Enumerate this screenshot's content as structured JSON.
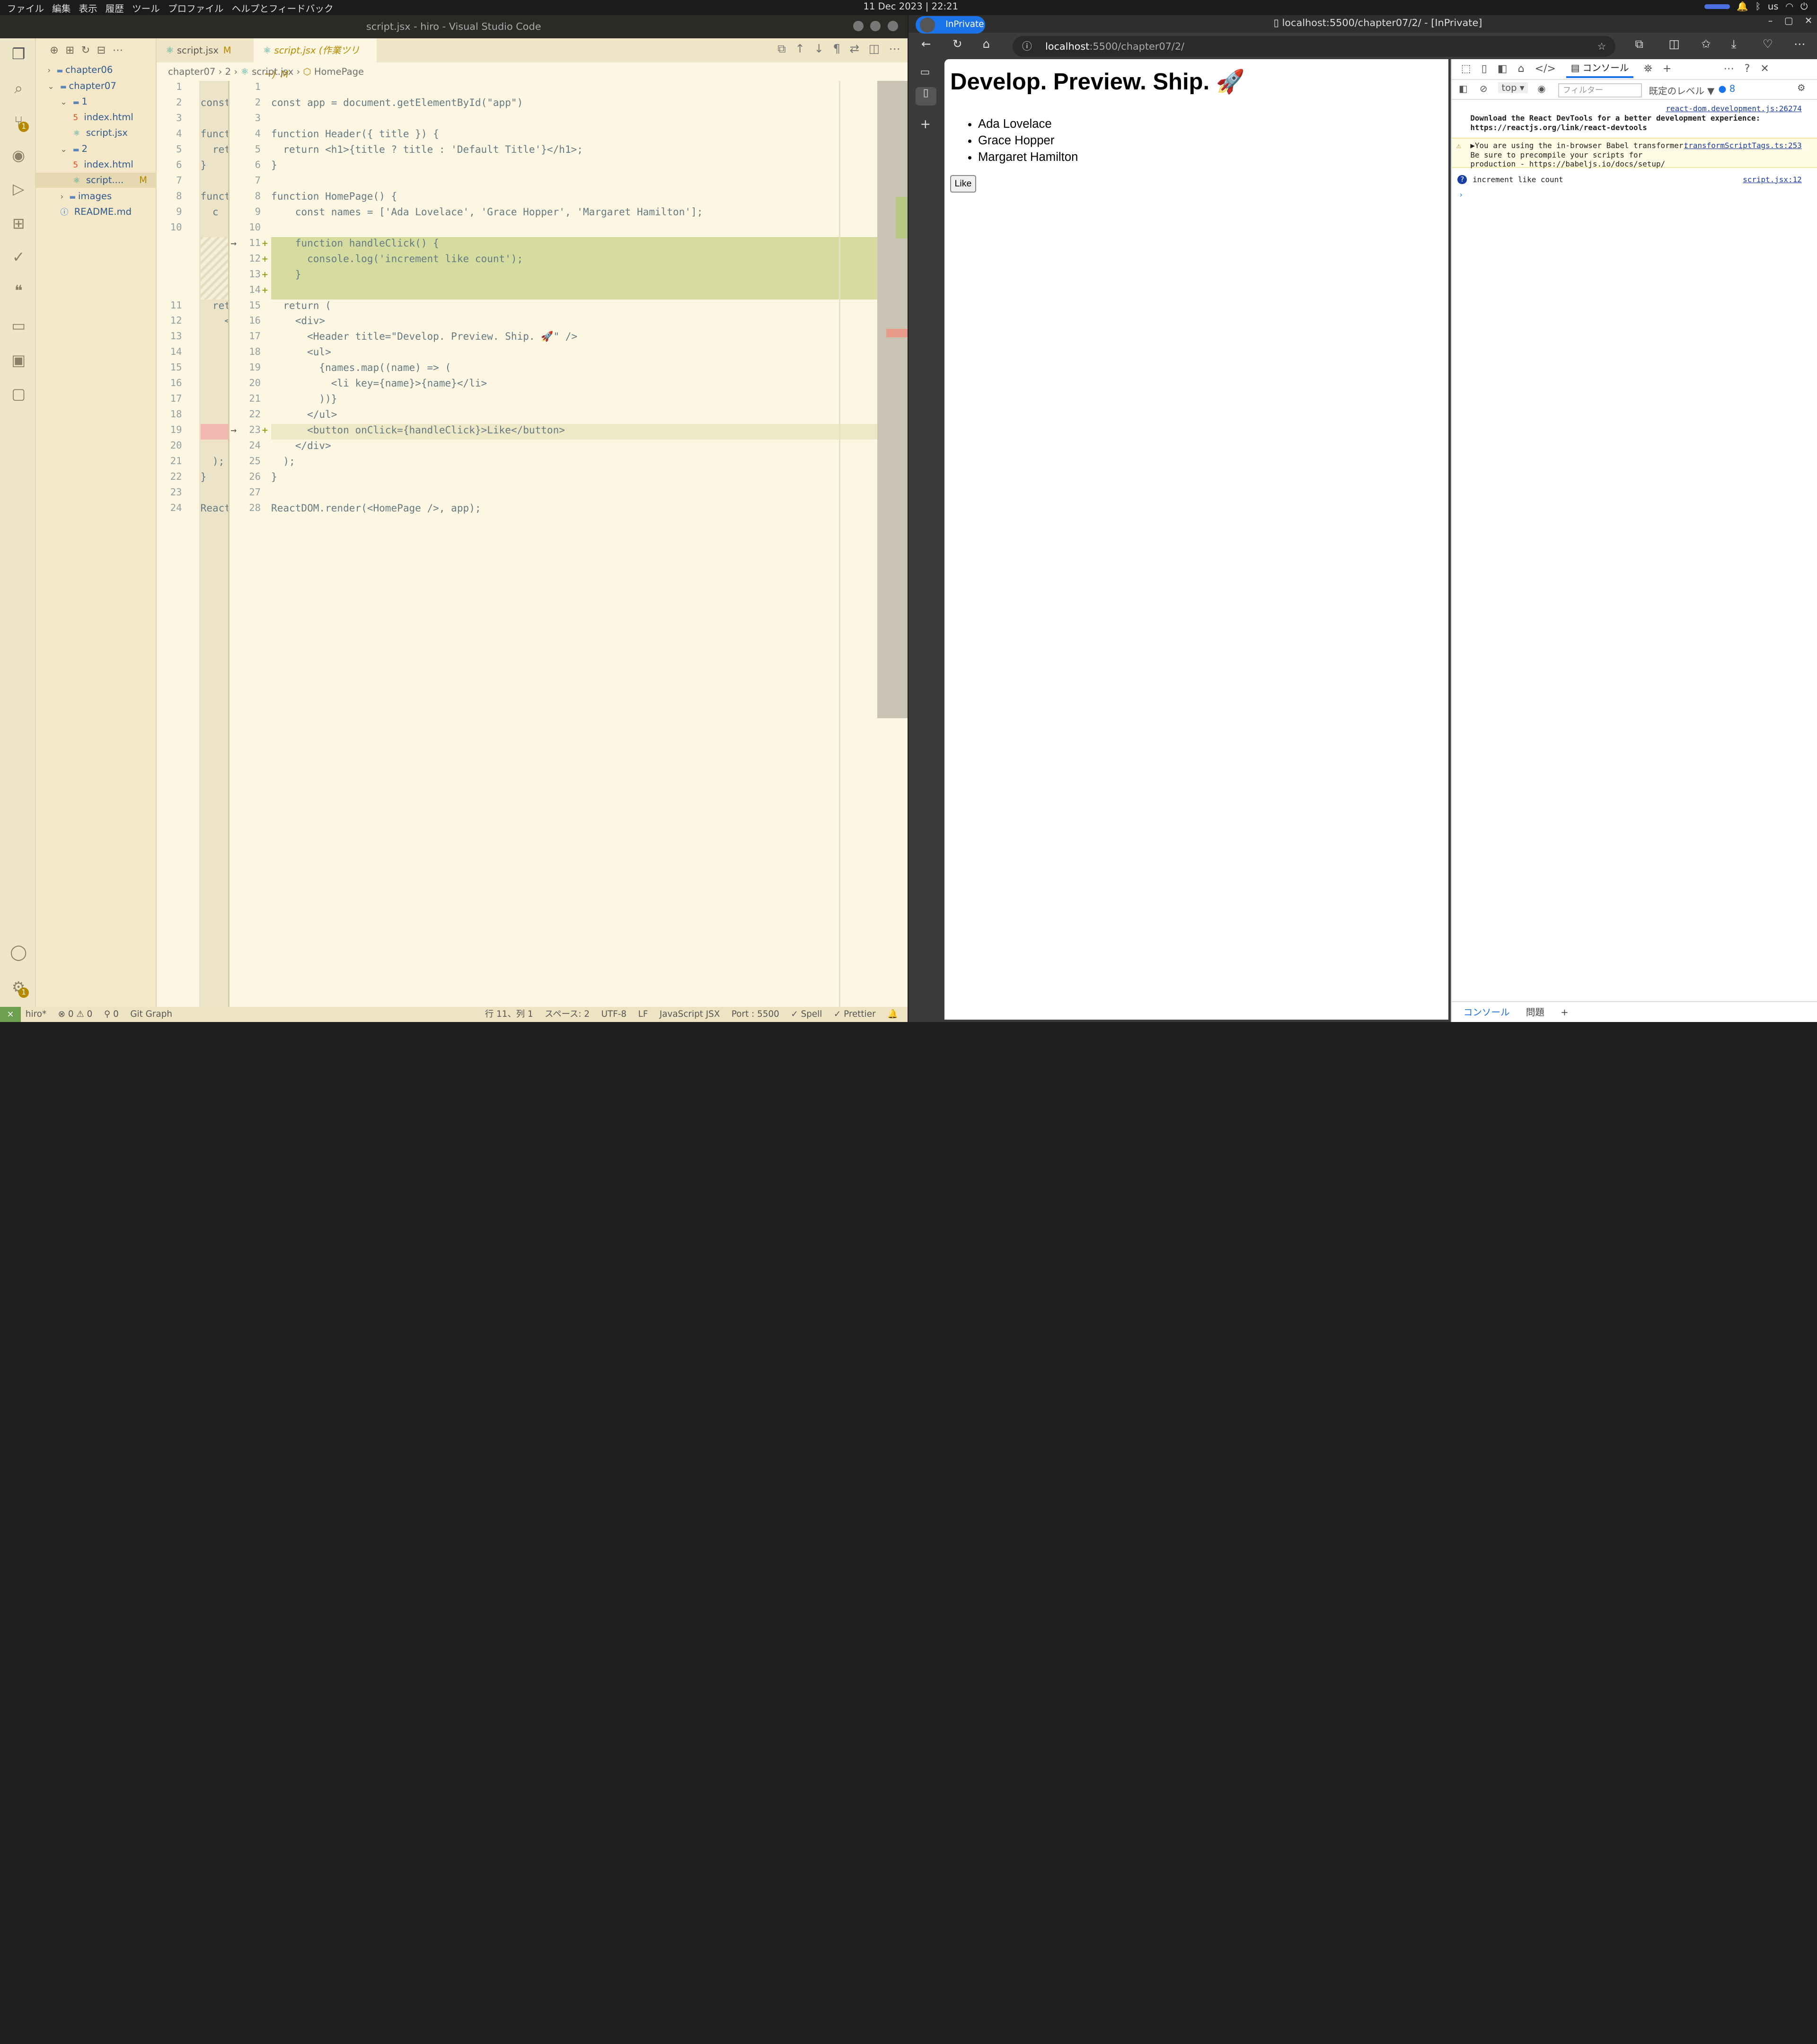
{
  "system": {
    "menu": [
      "ファイル",
      "編集",
      "表示",
      "履歴",
      "ツール",
      "プロファイル",
      "ヘルプとフィードバック"
    ],
    "clock": "11 Dec 2023 | 22:21",
    "keyboard": "us"
  },
  "vscode": {
    "title": "script.jsx - hiro - Visual Studio Code",
    "scm_badge": "1",
    "settings_badge": "1",
    "explorer": [
      {
        "label": "chapter06",
        "kind": "folder-closed",
        "depth": 0
      },
      {
        "label": "chapter07",
        "kind": "folder-open",
        "depth": 0
      },
      {
        "label": "1",
        "kind": "folder-open",
        "depth": 1
      },
      {
        "label": "index.html",
        "kind": "html",
        "depth": 2
      },
      {
        "label": "script.jsx",
        "kind": "jsx",
        "depth": 2
      },
      {
        "label": "2",
        "kind": "folder-open",
        "depth": 1
      },
      {
        "label": "index.html",
        "kind": "html",
        "depth": 2
      },
      {
        "label": "script....",
        "kind": "jsx",
        "depth": 2,
        "badge": "M"
      },
      {
        "label": "images",
        "kind": "folder-closed",
        "depth": 1
      },
      {
        "label": "README.md",
        "kind": "md",
        "depth": 1
      }
    ],
    "tabs": [
      {
        "label": "script.jsx",
        "badge": "M"
      },
      {
        "label": "script.jsx (作業ツリー)",
        "badge": "M"
      }
    ],
    "breadcrumb": [
      "chapter07",
      "2",
      "script.jsx",
      "HomePage"
    ],
    "left_lines": [
      {
        "n": "1",
        "t": ""
      },
      {
        "n": "2",
        "t": "const"
      },
      {
        "n": "3",
        "t": ""
      },
      {
        "n": "4",
        "t": "funct"
      },
      {
        "n": "5",
        "t": "  ret"
      },
      {
        "n": "6",
        "t": "}"
      },
      {
        "n": "7",
        "t": ""
      },
      {
        "n": "8",
        "t": "funct"
      },
      {
        "n": "9",
        "t": "  c"
      },
      {
        "n": "10",
        "t": ""
      },
      {
        "n": "11",
        "t": "  ret"
      },
      {
        "n": "12",
        "t": "    <"
      },
      {
        "n": "13",
        "t": ""
      },
      {
        "n": "14",
        "t": ""
      },
      {
        "n": "15",
        "t": ""
      },
      {
        "n": "16",
        "t": ""
      },
      {
        "n": "17",
        "t": ""
      },
      {
        "n": "18",
        "t": ""
      },
      {
        "n": "19",
        "t": ""
      },
      {
        "n": "20",
        "t": ""
      },
      {
        "n": "21",
        "t": "  );"
      },
      {
        "n": "22",
        "t": "}"
      },
      {
        "n": "23",
        "t": ""
      },
      {
        "n": "24",
        "t": "React"
      }
    ],
    "right_lines": [
      {
        "n": "1",
        "t": ""
      },
      {
        "n": "2",
        "t": "const app = document.getElementById(\"app\")"
      },
      {
        "n": "3",
        "t": ""
      },
      {
        "n": "4",
        "t": "function Header({ title }) {"
      },
      {
        "n": "5",
        "t": "  return <h1>{title ? title : 'Default Title'}</h1>;"
      },
      {
        "n": "6",
        "t": "}"
      },
      {
        "n": "7",
        "t": ""
      },
      {
        "n": "8",
        "t": "function HomePage() {"
      },
      {
        "n": "9",
        "t": "    const names = ['Ada Lovelace', 'Grace Hopper', 'Margaret Hamilton'];"
      },
      {
        "n": "10",
        "t": ""
      },
      {
        "n": "11",
        "t": "    function handleClick() {",
        "added": true
      },
      {
        "n": "12",
        "t": "      console.log('increment like count');",
        "added": true
      },
      {
        "n": "13",
        "t": "    }",
        "added": true
      },
      {
        "n": "14",
        "t": "",
        "added": true
      },
      {
        "n": "15",
        "t": "  return ("
      },
      {
        "n": "16",
        "t": "    <div>"
      },
      {
        "n": "17",
        "t": "      <Header title=\"Develop. Preview. Ship. 🚀\" />"
      },
      {
        "n": "18",
        "t": "      <ul>"
      },
      {
        "n": "19",
        "t": "        {names.map((name) => ("
      },
      {
        "n": "20",
        "t": "          <li key={name}>{name}</li>"
      },
      {
        "n": "21",
        "t": "        ))}"
      },
      {
        "n": "22",
        "t": "      </ul>"
      },
      {
        "n": "23",
        "t": "      <button onClick={handleClick}>Like</button>",
        "added": true
      },
      {
        "n": "24",
        "t": "    </div>"
      },
      {
        "n": "25",
        "t": "  );"
      },
      {
        "n": "26",
        "t": "}"
      },
      {
        "n": "27",
        "t": ""
      },
      {
        "n": "28",
        "t": "ReactDOM.render(<HomePage />, app);"
      }
    ],
    "status": {
      "remote": "⨯",
      "branch": "hiro*",
      "problems": "⊗ 0 ⚠ 0",
      "ports": "⚲ 0",
      "gitgraph": "Git Graph",
      "position": "行 11、列 1",
      "spaces": "スペース: 2",
      "encoding": "UTF-8",
      "eol": "LF",
      "language": "JavaScript JSX",
      "port": "Port : 5500",
      "spell": "✓ Spell",
      "prettier": "✓ Prettier"
    }
  },
  "browser": {
    "profile": "InPrivate",
    "title": "localhost:5500/chapter07/2/ - [InPrivate]",
    "url_host": "localhost",
    "url_path": ":5500/chapter07/2/",
    "page": {
      "heading": "Develop. Preview. Ship. 🚀",
      "items": [
        "Ada Lovelace",
        "Grace Hopper",
        "Margaret Hamilton"
      ],
      "button": "Like"
    },
    "devtools": {
      "tab_console": "コンソール",
      "context": "top",
      "filter_placeholder": "フィルター",
      "level": "既定のレベル ▼",
      "issues": "8",
      "messages": [
        {
          "src": "react-dom.development.js:26274",
          "text": "Download the React DevTools for a better development experience: https://reactjs.org/link/react-devtools",
          "kind": "info"
        },
        {
          "src": "transformScriptTags.ts:253",
          "text": "▶You are using the in-browser Babel transformer. Be sure to precompile your scripts for production - https://babeljs.io/docs/setup/",
          "kind": "warn"
        },
        {
          "src": "script.jsx:12",
          "text": "increment like count",
          "kind": "log"
        }
      ],
      "bottom_tabs": [
        "コンソール",
        "問題"
      ]
    }
  }
}
